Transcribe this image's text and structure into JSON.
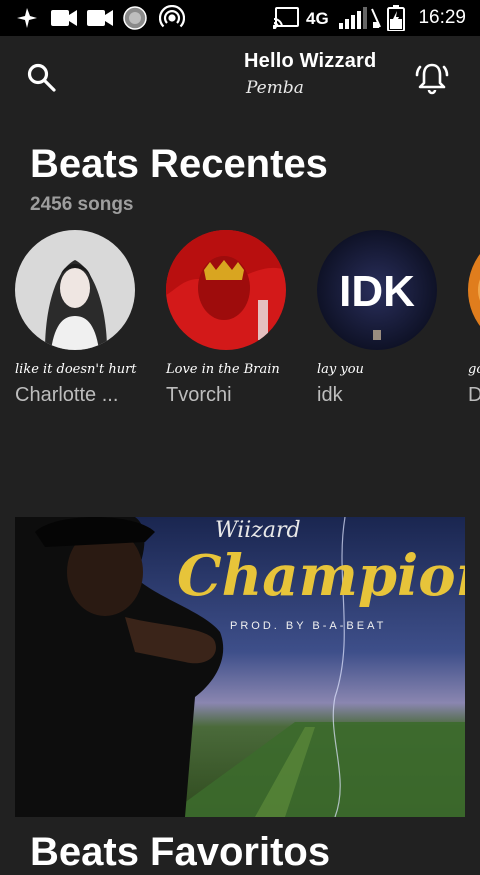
{
  "status_bar": {
    "time": "16:29",
    "network": "4G",
    "icons": [
      "pinwheel-icon",
      "video-icon",
      "video-icon",
      "circle-app-icon",
      "hotspot-icon",
      "cast-icon",
      "signal-icon",
      "mute-icon",
      "battery-icon"
    ]
  },
  "header": {
    "greeting": "Hello Wizzard",
    "username": "Pemba"
  },
  "recent": {
    "title": "Beats Recentes",
    "count": "2456 songs",
    "items": [
      {
        "tagline": "like it doesn't hurt",
        "artist": "Charlotte ...",
        "cover_color": "#d8d8d8"
      },
      {
        "tagline": "Love in the Brain",
        "artist": "Tvorchi",
        "cover_color": "#d11f1f"
      },
      {
        "tagline": "lay you",
        "artist": "idk",
        "cover_color": "#101530",
        "cover_text": "IDK"
      },
      {
        "tagline": "go",
        "artist": "D",
        "cover_color": "#e07d1d"
      }
    ]
  },
  "featured": {
    "artist_text": "Wiizard",
    "title": "Champion",
    "credit": "PROD. BY B-A-BEAT"
  },
  "favorites": {
    "title": "Beats Favoritos"
  }
}
